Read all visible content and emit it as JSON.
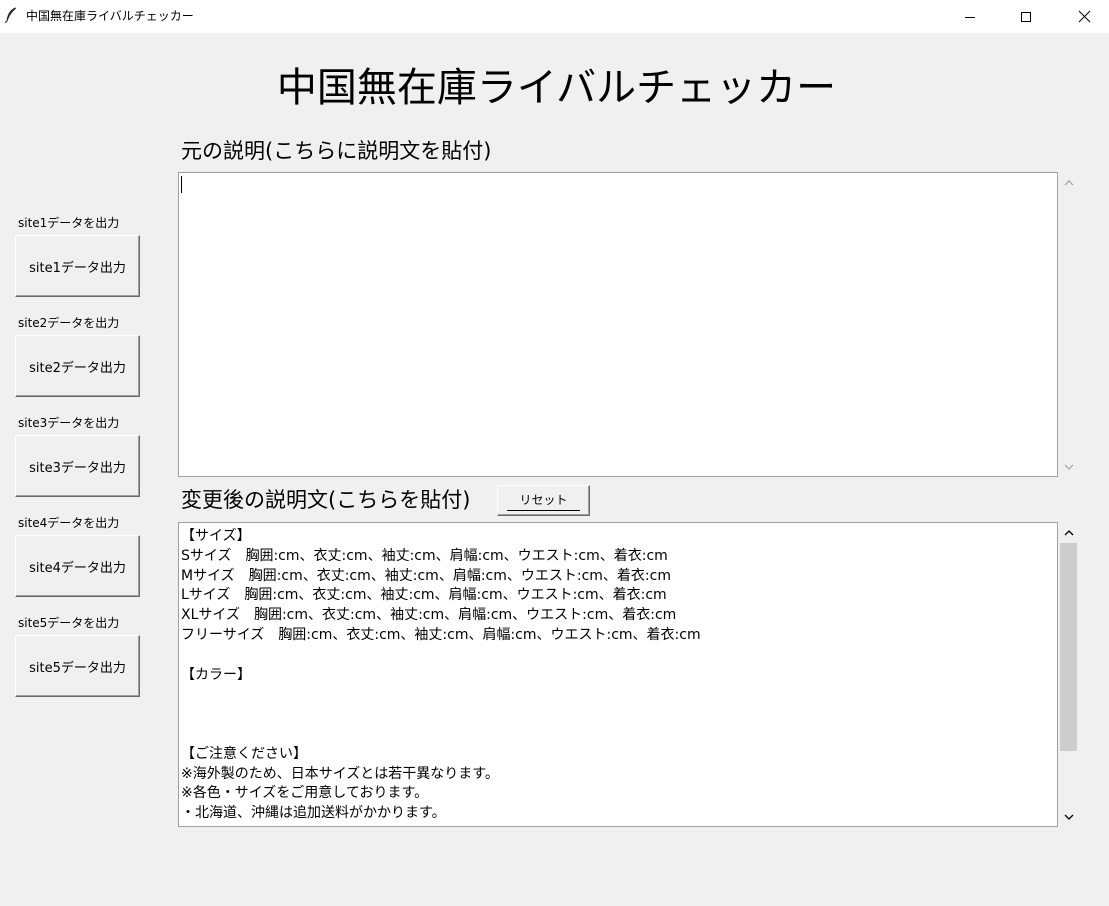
{
  "window": {
    "title": "中国無在庫ライバルチェッカー",
    "icon": "feather-icon",
    "controls": [
      "minimize-icon",
      "maximize-icon",
      "close-icon"
    ]
  },
  "heading": "中国無在庫ライバルチェッカー",
  "original": {
    "label": "元の説明(こちらに説明文を貼付)",
    "text": ""
  },
  "changed": {
    "label": "変更後の説明文(こちらを貼付)",
    "reset_label": "リセット",
    "lines": [
      "【サイズ】",
      "Sサイズ　胸囲:cm、衣丈:cm、袖丈:cm、肩幅:cm、ウエスト:cm、着衣:cm",
      "Mサイズ　胸囲:cm、衣丈:cm、袖丈:cm、肩幅:cm、ウエスト:cm、着衣:cm",
      "Lサイズ　胸囲:cm、衣丈:cm、袖丈:cm、肩幅:cm、ウエスト:cm、着衣:cm",
      "XLサイズ　胸囲:cm、衣丈:cm、袖丈:cm、肩幅:cm、ウエスト:cm、着衣:cm",
      "フリーサイズ　胸囲:cm、衣丈:cm、袖丈:cm、肩幅:cm、ウエスト:cm、着衣:cm",
      "",
      "【カラー】",
      "",
      "",
      "",
      "【ご注意ください】",
      "※海外製のため、日本サイズとは若干異なります。",
      "※各色・サイズをご用意しております。",
      "・北海道、沖縄は追加送料がかかります。"
    ]
  },
  "sites": [
    {
      "label": "site1データを出力",
      "button": "site1データ出力"
    },
    {
      "label": "site2データを出力",
      "button": "site2データ出力"
    },
    {
      "label": "site3データを出力",
      "button": "site3データ出力"
    },
    {
      "label": "site4データを出力",
      "button": "site4データ出力"
    },
    {
      "label": "site5データを出力",
      "button": "site5データ出力"
    }
  ]
}
